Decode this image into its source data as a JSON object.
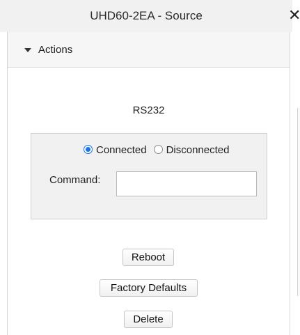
{
  "window": {
    "title": "UHD60-2EA - Source",
    "close_glyph": "✕"
  },
  "accordion": {
    "label": "Actions",
    "expanded": true,
    "icon": "caret-down-icon"
  },
  "rs232": {
    "title": "RS232",
    "connection_options": [
      "Connected",
      "Disconnected"
    ],
    "selected_connection": "Connected",
    "command_label": "Command:",
    "command_value": "",
    "command_placeholder": ""
  },
  "buttons": {
    "reboot": "Reboot",
    "factory_defaults": "Factory Defaults",
    "delete": "Delete"
  },
  "colors": {
    "accent": "#1a73e8",
    "titlebar_bg": "#f1f1f1",
    "box_bg": "#f1f1f1"
  }
}
